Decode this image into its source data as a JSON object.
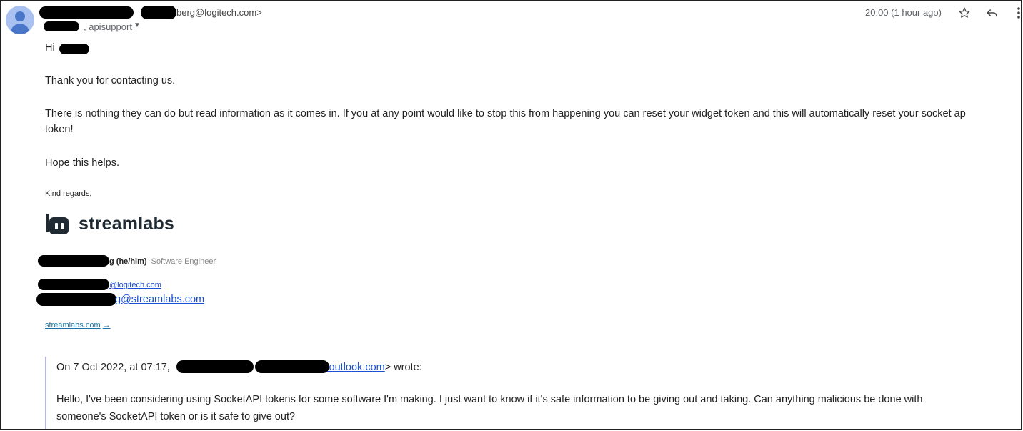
{
  "header": {
    "sender_email_suffix": "berg@logitech.com>",
    "recipients_suffix": ", apisupport",
    "time": "20:00 (1 hour ago)"
  },
  "icons": {
    "avatar": "person-avatar-icon",
    "star": "star-icon",
    "reply": "reply-icon",
    "more": "more-vert-icon",
    "dropdown": "caret-down-icon"
  },
  "body": {
    "greeting": "Hi",
    "line1": "Thank you for contacting us.",
    "line2a": "There is nothing they can do but read information as it comes in. If you at any point would like to stop this from happening you can reset your widget token and this will automatically reset your socket ap",
    "line2b": "token!",
    "line3": "Hope this helps.",
    "closing": "Kind regards,"
  },
  "signature": {
    "brand": "streamlabs",
    "name_suffix": "g (he/him)",
    "role": "Software Engineer",
    "email1_suffix": "@logitech.com",
    "email2_suffix": "g@streamlabs.com",
    "website": "streamlabs.com",
    "website_arrow": "→"
  },
  "quoted": {
    "intro_prefix": "On 7 Oct 2022, at 07:17,",
    "intro_email": "@outlook.com",
    "intro_suffix": "> wrote:",
    "line1": "Hello, I've been considering using SocketAPI tokens for some software I'm making. I just want to know if it's safe information to be giving out and taking. Can anything malicious be done with",
    "line2": "someone's SocketAPI token or is it safe to give out?"
  },
  "colors": {
    "link": "#1a4fd6",
    "quote_bar": "#b4b8e6",
    "avatar_bg": "#a8c1f0",
    "avatar_fg": "#4a76c9",
    "redaction": "#000000"
  }
}
